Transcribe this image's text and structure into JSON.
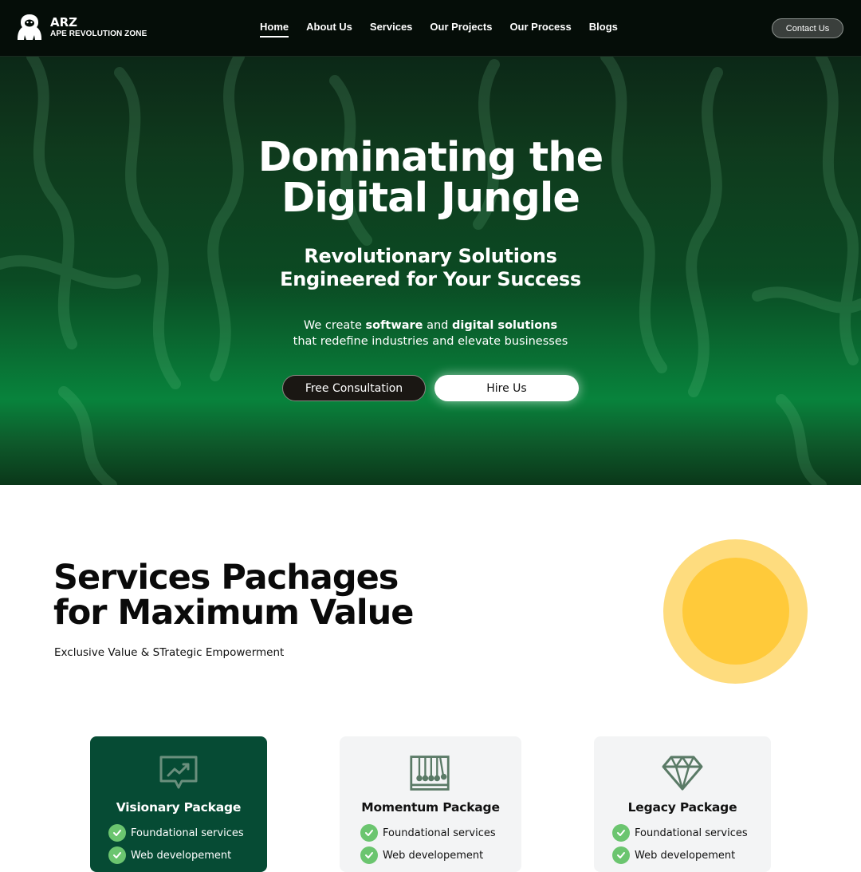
{
  "brand": {
    "name": "ARZ",
    "tagline": "APE REVOLUTION ZONE"
  },
  "nav": {
    "items": [
      {
        "label": "Home",
        "active": true
      },
      {
        "label": "About Us",
        "active": false
      },
      {
        "label": "Services",
        "active": false
      },
      {
        "label": "Our Projects",
        "active": false
      },
      {
        "label": "Our Process",
        "active": false
      },
      {
        "label": "Blogs",
        "active": false
      }
    ],
    "contact_label": "Contact Us"
  },
  "hero": {
    "title_line1": "Dominating the",
    "title_line2": "Digital Jungle",
    "subtitle_line1": "Revolutionary Solutions",
    "subtitle_line2": "Engineered for Your Success",
    "desc_prefix": "We create",
    "desc_bold1": "software",
    "desc_and": "and",
    "desc_bold2": "digital solutions",
    "desc_line2": "that redefine industries and elevate businesses",
    "btn_consult": "Free Consultation",
    "btn_hire": "Hire Us"
  },
  "services": {
    "title_line1": "Services Pachages",
    "title_line2": "for Maximum Value",
    "tagline": "Exclusive Value & STrategic Empowerment",
    "packages": [
      {
        "title": "Visionary Package",
        "icon": "chart-chat-icon",
        "features": [
          "Foundational services",
          "Web developement"
        ]
      },
      {
        "title": "Momentum Package",
        "icon": "newtons-cradle-icon",
        "features": [
          "Foundational services",
          "Web developement"
        ]
      },
      {
        "title": "Legacy Package",
        "icon": "diamond-icon",
        "features": [
          "Foundational services",
          "Web developement"
        ]
      }
    ]
  },
  "colors": {
    "nav_bg": "#050d08",
    "hero_green": "#08833c",
    "card_dark": "#064b34",
    "card_light": "#f3f4f5",
    "check_green": "#6bc56f",
    "sun": "#ffca3a"
  }
}
